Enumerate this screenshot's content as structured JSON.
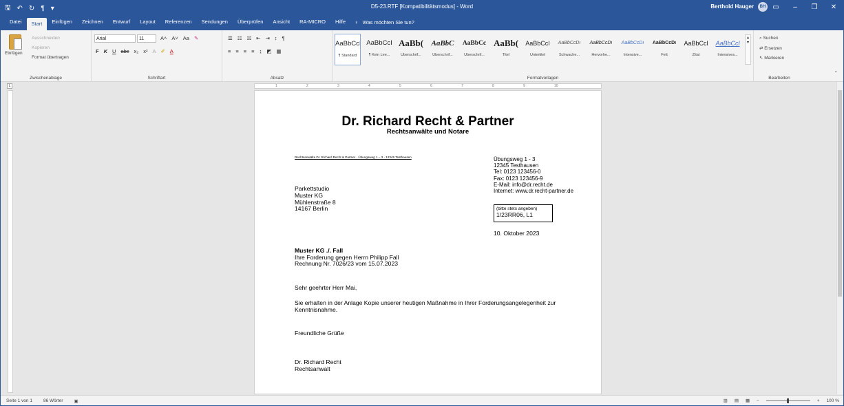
{
  "window": {
    "title": "D5-23.RTF [Kompatibilitätsmodus] - Word",
    "user_name": "Berthold Hauger",
    "user_initials": "BH"
  },
  "tabs": [
    "Datei",
    "Start",
    "Einfügen",
    "Zeichnen",
    "Entwurf",
    "Layout",
    "Referenzen",
    "Sendungen",
    "Überprüfen",
    "Ansicht",
    "RA-MICRO",
    "Hilfe"
  ],
  "tell_me": "Was möchten Sie tun?",
  "clipboard": {
    "paste": "Einfügen",
    "cut": "Ausschneiden",
    "copy": "Kopieren",
    "format_painter": "Format übertragen",
    "label": "Zwischenablage"
  },
  "font": {
    "name": "Arial",
    "size": "11",
    "label": "Schriftart",
    "buttons": [
      "F",
      "K",
      "U",
      "abc",
      "x₂",
      "x²"
    ]
  },
  "paragraph": {
    "label": "Absatz"
  },
  "styles": {
    "label": "Formatvorlagen",
    "items": [
      {
        "preview": "AaBbCcI",
        "caption": "¶ Standard"
      },
      {
        "preview": "AaBbCcI",
        "caption": "¶ Kein Lee..."
      },
      {
        "preview": "AaBb(",
        "caption": "Überschrif..."
      },
      {
        "preview": "AaBbC",
        "caption": "Überschrif..."
      },
      {
        "preview": "AaBbCc",
        "caption": "Überschrif..."
      },
      {
        "preview": "AaBb(",
        "caption": "Titel"
      },
      {
        "preview": "AaBbCcI",
        "caption": "Untertitel"
      },
      {
        "preview": "AaBbCcDı",
        "caption": "Schwache..."
      },
      {
        "preview": "AaBbCcDı",
        "caption": "Hervorhe..."
      },
      {
        "preview": "AaBbCcDı",
        "caption": "Intensive..."
      },
      {
        "preview": "AaBbCcDı",
        "caption": "Fett"
      },
      {
        "preview": "AaBbCcl",
        "caption": "Zitat"
      },
      {
        "preview": "AaBbCcl",
        "caption": "Intensives..."
      }
    ]
  },
  "editing": {
    "label": "Bearbeiten",
    "find": "Suchen",
    "replace": "Ersetzen",
    "select": "Markieren"
  },
  "document": {
    "firm_name": "Dr. Richard Recht & Partner",
    "firm_subtitle": "Rechtsanwälte und Notare",
    "sender_line": "Rechtsanwälte Dr. Richard Recht & Partner · Übungsweg 1 – 3 · 12345 Testhausen",
    "contact": [
      "Übungsweg 1 - 3",
      "12345 Testhausen",
      "Tel:  0123 123456-0",
      "Fax: 0123 123456-9",
      "E-Mail: info@dr.recht.de",
      "Internet: www.dr.recht-partner.de"
    ],
    "recipient": [
      "Parkettstudio",
      "Muster KG",
      "Mühlenstraße 8",
      "14167 Berlin"
    ],
    "reference_hint": "(bitte stets angeben)",
    "reference_number": "1/23RR06, L1",
    "date": "10. Oktober 2023",
    "subject_bold": "Muster KG ./. Fall",
    "subject_lines": [
      "Ihre Forderung gegen Herrn Philipp Fall",
      "Rechnung Nr. 7026/23 vom 15.07.2023"
    ],
    "salutation": "Sehr geehrter Herr Mai,",
    "body": "Sie erhalten in der Anlage Kopie unserer heutigen Maßnahme in Ihrer Forderungsangelegenheit zur Kenntnisnahme.",
    "closing": "Freundliche Grüße",
    "signature": [
      "Dr. Richard Recht",
      "Rechtsanwalt"
    ]
  },
  "status": {
    "page": "Seite 1 von 1",
    "words": "86 Wörter",
    "zoom": "100 %"
  }
}
